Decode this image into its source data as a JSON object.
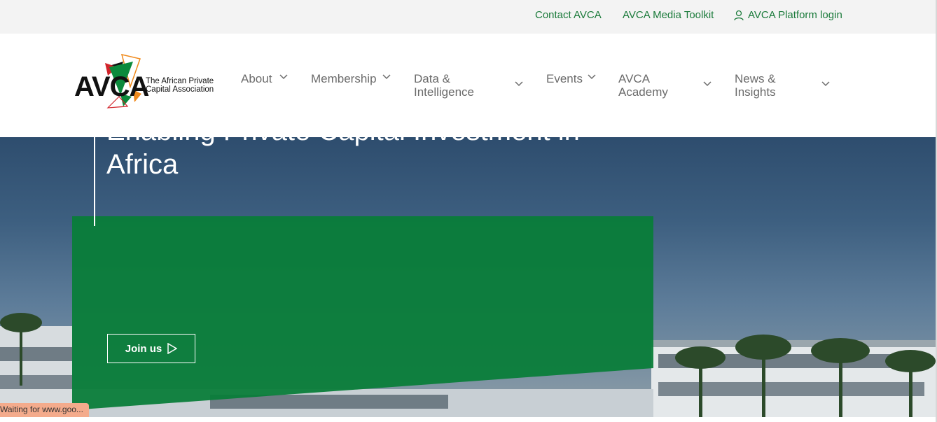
{
  "topbar": {
    "contact": "Contact AVCA",
    "toolkit": "AVCA Media Toolkit",
    "login": "AVCA Platform login"
  },
  "logo": {
    "wordmark": "AVCA",
    "tagline_line1": "The African Private",
    "tagline_line2": "Capital Association"
  },
  "nav": {
    "about": "About",
    "membership": "Membership",
    "data_line1": "Data &",
    "data_line2": "Intelligence",
    "events": "Events",
    "academy_line1": "AVCA",
    "academy_line2": "Academy",
    "news_line1": "News &",
    "news_line2": "Insights"
  },
  "hero": {
    "title_line1": "Enabling Private Capital Investment in",
    "title_line2": "Africa",
    "cta": "Join us"
  },
  "status_bar": "Waiting for www.goo...",
  "colors": {
    "brand_green": "#087d38",
    "link_green": "#1a7a3a",
    "nav_grey": "#6b6b6b",
    "topbar_bg": "#f3f3f3"
  }
}
